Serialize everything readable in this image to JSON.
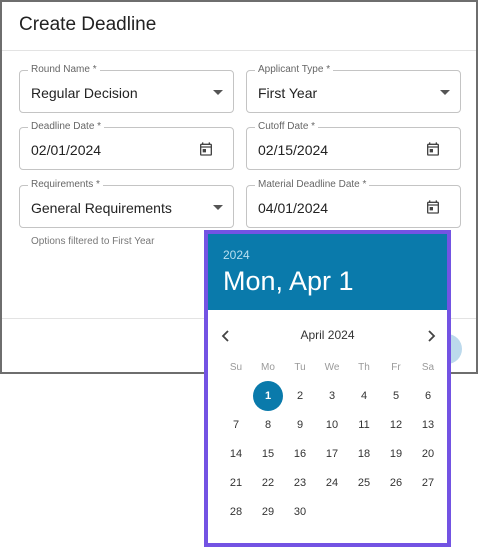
{
  "dialog": {
    "title": "Create Deadline",
    "fields": {
      "round_name": {
        "label": "Round Name *",
        "value": "Regular Decision"
      },
      "applicant_type": {
        "label": "Applicant Type *",
        "value": "First Year"
      },
      "deadline_date": {
        "label": "Deadline Date *",
        "value": "02/01/2024"
      },
      "cutoff_date": {
        "label": "Cutoff Date *",
        "value": "02/15/2024"
      },
      "requirements": {
        "label": "Requirements *",
        "value": "General Requirements",
        "helper": "Options filtered to First Year"
      },
      "material_deadline_date": {
        "label": "Material Deadline Date *",
        "value": "04/01/2024"
      }
    }
  },
  "picker": {
    "year": "2024",
    "selected_label": "Mon, Apr 1",
    "month_label": "April 2024",
    "weekdays": [
      "Su",
      "Mo",
      "Tu",
      "We",
      "Th",
      "Fr",
      "Sa"
    ],
    "weeks": [
      [
        "",
        "1",
        "2",
        "3",
        "4",
        "5",
        "6"
      ],
      [
        "7",
        "8",
        "9",
        "10",
        "11",
        "12",
        "13"
      ],
      [
        "14",
        "15",
        "16",
        "17",
        "18",
        "19",
        "20"
      ],
      [
        "21",
        "22",
        "23",
        "24",
        "25",
        "26",
        "27"
      ],
      [
        "28",
        "29",
        "30",
        "",
        "",
        "",
        ""
      ]
    ],
    "selected_day": "1",
    "accent_color": "#0a7aab",
    "highlight_border_color": "#7353e3",
    "icons": {
      "prev": "chevron-left-icon",
      "next": "chevron-right-icon",
      "calendar": "calendar-icon",
      "dropdown": "dropdown-caret-icon"
    }
  }
}
